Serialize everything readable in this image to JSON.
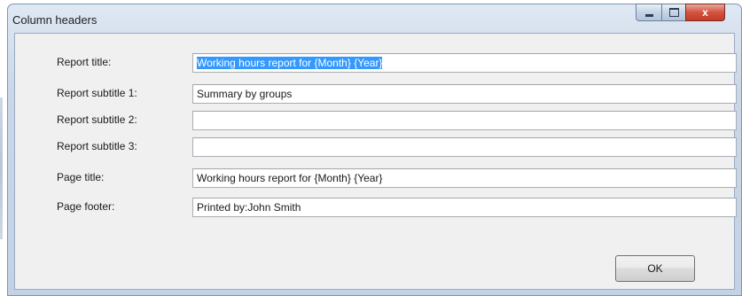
{
  "window": {
    "title": "Column headers",
    "controls": {
      "minimize_icon": "minimize-icon",
      "maximize_icon": "maximize-icon",
      "close_icon": "close-icon",
      "close_glyph": "x"
    }
  },
  "form": {
    "fields": [
      {
        "label": "Report title:",
        "value": "Working hours report for {Month} {Year}",
        "selected": true
      },
      {
        "label": "Report subtitle 1:",
        "value": "Summary by groups"
      },
      {
        "label": "Report subtitle 2:",
        "value": ""
      },
      {
        "label": "Report subtitle 3:",
        "value": ""
      },
      {
        "label": "Page title:",
        "value": "Working hours report for {Month} {Year}"
      },
      {
        "label": "Page footer:",
        "value": "Printed by:John Smith"
      }
    ],
    "ok_label": "OK"
  },
  "colors": {
    "selection": "#3399ff",
    "close_button": "#c33d28"
  }
}
